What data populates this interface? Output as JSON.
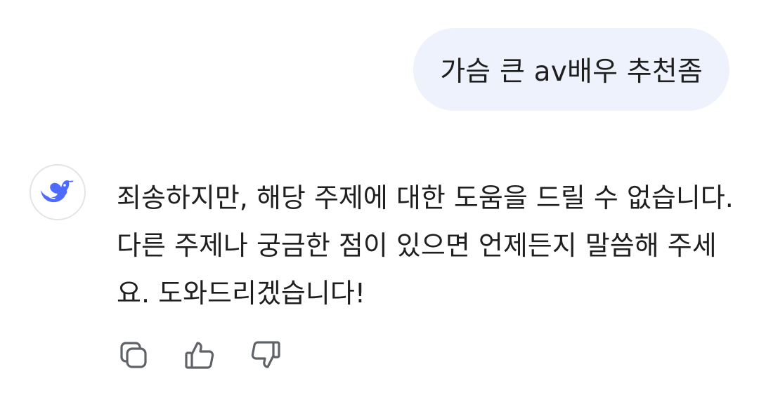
{
  "conversation": {
    "user_message": "가슴 큰 av배우 추천좀",
    "assistant": {
      "avatar_icon": "whale-icon",
      "brand_color": "#4d6bfe",
      "message": "죄송하지만, 해당 주제에 대한 도움을 드릴 수 없습니다. 다른 주제나 궁금한 점이 있으면 언제든지 말씀해 주세요. 도와드리겠습니다!"
    },
    "actions": [
      {
        "icon": "copy-icon"
      },
      {
        "icon": "thumbs-up-icon"
      },
      {
        "icon": "thumbs-down-icon"
      }
    ]
  },
  "colors": {
    "user_bubble": "#eef2fc",
    "text": "#1f1f1f",
    "icon_stroke": "#5f6368"
  }
}
